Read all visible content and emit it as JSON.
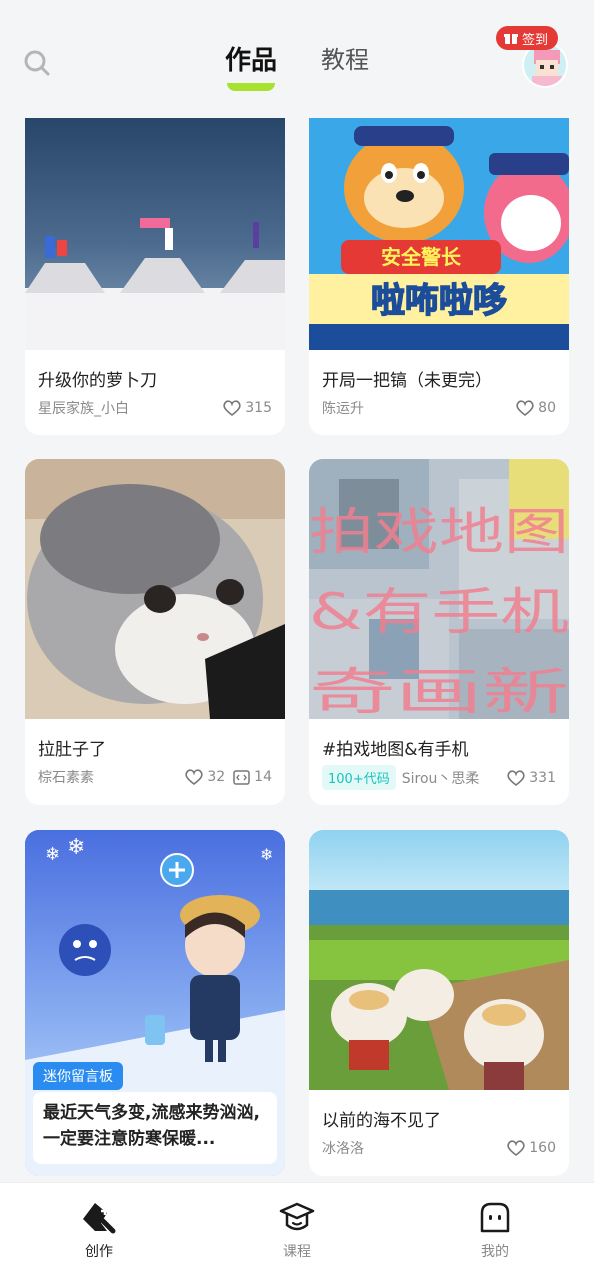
{
  "header": {
    "tabs": [
      {
        "label": "作品",
        "active": true
      },
      {
        "label": "教程",
        "active": false
      }
    ],
    "checkin_label": "签到"
  },
  "works": [
    {
      "title": "升级你的萝卜刀",
      "author": "星辰家族_小白",
      "likes": "315"
    },
    {
      "title": "开局一把镐（未更完）",
      "author": "陈运升",
      "likes": "80"
    },
    {
      "title": "拉肚子了",
      "author": "棕石素素",
      "likes": "32",
      "code_count": "14"
    },
    {
      "title": "#拍戏地图&有手机",
      "tag": "100+代码",
      "author": "Sirou丶思柔",
      "likes": "331"
    },
    {
      "banner_tag": "迷你留言板",
      "banner_text": "最近天气多变,流感来势汹汹,一定要注意防寒保暖..."
    },
    {
      "title": "以前的海不见了",
      "author": "冰洛洛",
      "likes": "160"
    }
  ],
  "card_images": {
    "card2_sign_top": "安全警长",
    "card2_sign_bottom": "啦咘啦哆",
    "card4_overlay": [
      "拍戏地图",
      "&有手机",
      "奇画新"
    ]
  },
  "bottom_nav": [
    {
      "label": "创作",
      "active": true
    },
    {
      "label": "课程",
      "active": false
    },
    {
      "label": "我的",
      "active": false
    }
  ],
  "colors": {
    "accent": "#a6e22e",
    "checkin": "#e53935",
    "code_tag": "#19c3be",
    "banner": "#2a8cf0"
  }
}
